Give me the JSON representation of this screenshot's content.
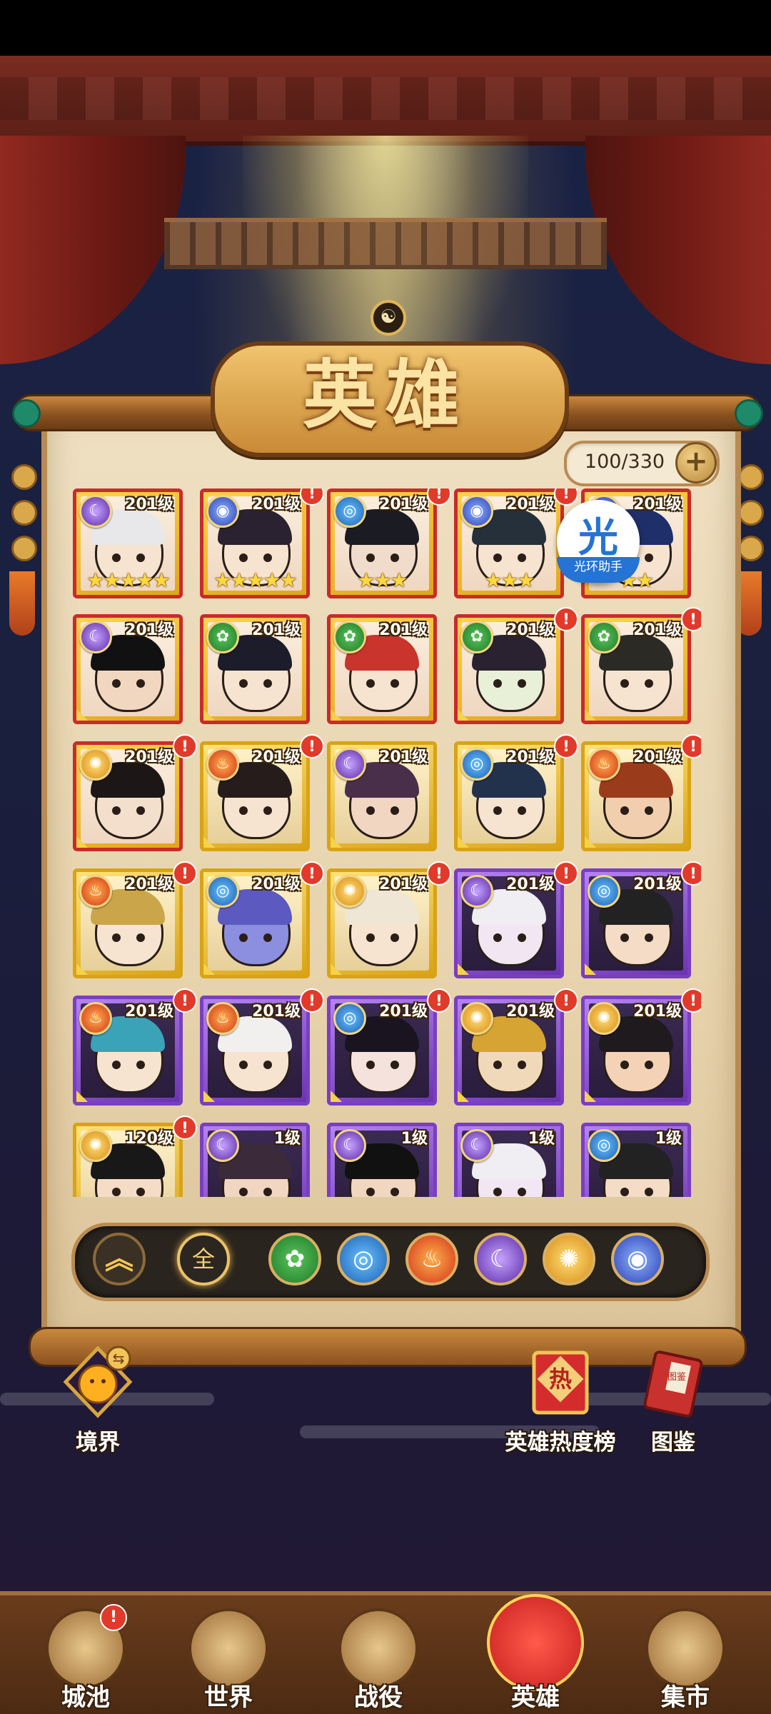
{
  "header": {
    "title": "英雄",
    "hero_count": "100/330",
    "plus_label": "+"
  },
  "helper": {
    "icon_text": "光",
    "label": "光环助手"
  },
  "heroes": [
    {
      "level": "201级",
      "stars": "★★★★★",
      "element": "moon",
      "frame": "red",
      "alert": false,
      "hair": "#e8e8ea",
      "face": "#f7e4d0"
    },
    {
      "level": "201级",
      "stars": "★★★★★",
      "element": "swirl",
      "frame": "red",
      "alert": true,
      "hair": "#2a2230",
      "face": "#f7e4d0"
    },
    {
      "level": "201级",
      "stars": "★★★",
      "element": "water",
      "frame": "red",
      "alert": true,
      "hair": "#1b1b24",
      "face": "#f1dccb"
    },
    {
      "level": "201级",
      "stars": "★★★",
      "element": "swirl",
      "frame": "red",
      "alert": true,
      "hair": "#25303a",
      "face": "#f7e4d0"
    },
    {
      "level": "201级",
      "stars": "★★",
      "element": "swirl",
      "frame": "red",
      "alert": false,
      "hair": "#1e2f6a",
      "face": "#f7e4d0"
    },
    {
      "level": "201级",
      "stars": "",
      "element": "moon",
      "frame": "red",
      "alert": false,
      "hair": "#111",
      "face": "#f2d7c0"
    },
    {
      "level": "201级",
      "stars": "",
      "element": "nature",
      "frame": "red",
      "alert": false,
      "hair": "#1c1c2a",
      "face": "#f7e4d0"
    },
    {
      "level": "201级",
      "stars": "",
      "element": "nature",
      "frame": "red",
      "alert": false,
      "hair": "#c9342c",
      "face": "#f7e4d0"
    },
    {
      "level": "201级",
      "stars": "",
      "element": "nature",
      "frame": "red",
      "alert": true,
      "hair": "#2a2230",
      "face": "#e9f0d8"
    },
    {
      "level": "201级",
      "stars": "",
      "element": "nature",
      "frame": "red",
      "alert": true,
      "hair": "#2b2a24",
      "face": "#f7e4d0"
    },
    {
      "level": "201级",
      "stars": "",
      "element": "sun",
      "frame": "red",
      "alert": true,
      "hair": "#1c1616",
      "face": "#f4dfcc"
    },
    {
      "level": "201级",
      "stars": "",
      "element": "fire",
      "frame": "gold",
      "alert": true,
      "hair": "#261c1c",
      "face": "#f7e4d0"
    },
    {
      "level": "201级",
      "stars": "",
      "element": "moon",
      "frame": "gold",
      "alert": false,
      "hair": "#4a2f4a",
      "face": "#f1d6c2"
    },
    {
      "level": "201级",
      "stars": "",
      "element": "water",
      "frame": "gold",
      "alert": true,
      "hair": "#23324c",
      "face": "#f7e4d0"
    },
    {
      "level": "201级",
      "stars": "",
      "element": "fire",
      "frame": "gold",
      "alert": true,
      "hair": "#9a3c1c",
      "face": "#f1cfae"
    },
    {
      "level": "201级",
      "stars": "",
      "element": "fire",
      "frame": "gold",
      "alert": true,
      "hair": "#caa54a",
      "face": "#f7e4d0"
    },
    {
      "level": "201级",
      "stars": "",
      "element": "water",
      "frame": "gold",
      "alert": true,
      "hair": "#5c5ac0",
      "face": "#8c8ee0"
    },
    {
      "level": "201级",
      "stars": "",
      "element": "sun",
      "frame": "gold",
      "alert": true,
      "hair": "#efe6d6",
      "face": "#f7e4d0"
    },
    {
      "level": "201级",
      "stars": "",
      "element": "moon",
      "frame": "purple",
      "alert": true,
      "hair": "#f0eef2",
      "face": "#f2e6f2"
    },
    {
      "level": "201级",
      "stars": "",
      "element": "water",
      "frame": "purple",
      "alert": true,
      "hair": "#222",
      "face": "#f4dcc6"
    },
    {
      "level": "201级",
      "stars": "",
      "element": "fire",
      "frame": "purple",
      "alert": true,
      "hair": "#3aa3b8",
      "face": "#f7e4d0"
    },
    {
      "level": "201级",
      "stars": "",
      "element": "fire",
      "frame": "purple",
      "alert": true,
      "hair": "#f2f0ee",
      "face": "#f7e4d0"
    },
    {
      "level": "201级",
      "stars": "",
      "element": "water",
      "frame": "purple",
      "alert": true,
      "hair": "#1a1420",
      "face": "#f6e2dc"
    },
    {
      "level": "201级",
      "stars": "",
      "element": "sun",
      "frame": "purple",
      "alert": true,
      "hair": "#d6a432",
      "face": "#f0d9b8"
    },
    {
      "level": "201级",
      "stars": "",
      "element": "sun",
      "frame": "purple",
      "alert": true,
      "hair": "#1e1a1e",
      "face": "#f3d2b6"
    },
    {
      "level": "120级",
      "stars": "",
      "element": "sun",
      "frame": "gold",
      "alert": true,
      "hair": "#181818",
      "face": "#f4dcc6"
    },
    {
      "level": "1级",
      "stars": "",
      "element": "moon",
      "frame": "purple",
      "alert": false,
      "hair": "#3a2a3a",
      "face": "#f1d6c2"
    },
    {
      "level": "1级",
      "stars": "",
      "element": "moon",
      "frame": "purple",
      "alert": false,
      "hair": "#111",
      "face": "#f2d7c0"
    },
    {
      "level": "1级",
      "stars": "",
      "element": "moon",
      "frame": "purple",
      "alert": false,
      "hair": "#f0eef2",
      "face": "#f2e6f2"
    },
    {
      "level": "1级",
      "stars": "",
      "element": "water",
      "frame": "purple",
      "alert": false,
      "hair": "#222",
      "face": "#f4dcc6"
    }
  ],
  "filters": {
    "collapse_label": "︽",
    "all_label": "全",
    "elements": [
      {
        "name": "nature",
        "glyph": "✿"
      },
      {
        "name": "water",
        "glyph": "◎"
      },
      {
        "name": "fire",
        "glyph": "♨"
      },
      {
        "name": "moon",
        "glyph": "☾"
      },
      {
        "name": "sun",
        "glyph": "✺"
      },
      {
        "name": "swirl",
        "glyph": "◉"
      }
    ]
  },
  "side_buttons": {
    "realm": "境界",
    "hot_rank": "英雄热度榜",
    "encyclopedia": "图鉴",
    "realm_swap": "⇆",
    "rank_seal": "热",
    "book_label": "图鉴"
  },
  "nav": [
    {
      "label": "城池",
      "icon": "castle-icon",
      "badge": "!"
    },
    {
      "label": "世界",
      "icon": "world-icon",
      "badge": ""
    },
    {
      "label": "战役",
      "icon": "battle-icon",
      "badge": ""
    },
    {
      "label": "英雄",
      "icon": "hero-icon",
      "badge": ""
    },
    {
      "label": "集市",
      "icon": "market-icon",
      "badge": ""
    }
  ],
  "alert_glyph": "!"
}
